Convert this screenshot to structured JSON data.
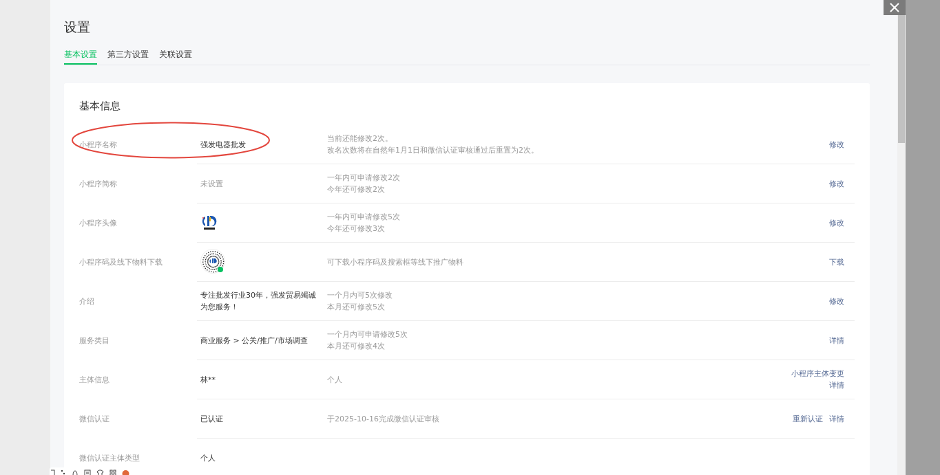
{
  "dialog": {
    "title": "设置"
  },
  "tabs": [
    {
      "label": "基本设置",
      "selected": true
    },
    {
      "label": "第三方设置",
      "selected": false
    },
    {
      "label": "关联设置",
      "selected": false
    }
  ],
  "section": {
    "title": "基本信息"
  },
  "rows": [
    {
      "label": "小程序名称",
      "kind": "text",
      "value": "强发电器批发",
      "muted": false,
      "highlighted": true,
      "desc": [
        "当前还能修改2次。",
        "改名次数将在自然年1月1日和微信认证审核通过后重置为2次。"
      ],
      "actions": [
        [
          "修改"
        ]
      ]
    },
    {
      "label": "小程序简称",
      "kind": "text",
      "value": "未设置",
      "muted": true,
      "highlighted": false,
      "desc": [
        "一年内可申请修改2次",
        "今年还可修改2次"
      ],
      "actions": [
        [
          "修改"
        ]
      ]
    },
    {
      "label": "小程序头像",
      "kind": "logo",
      "highlighted": false,
      "desc": [
        "一年内可申请修改5次",
        "今年还可修改3次"
      ],
      "actions": [
        [
          "修改"
        ]
      ]
    },
    {
      "label": "小程序码及线下物料下载",
      "kind": "qrcode",
      "highlighted": false,
      "desc": [
        "可下载小程序码及搜索框等线下推广物料"
      ],
      "actions": [
        [
          "下载"
        ]
      ]
    },
    {
      "label": "介绍",
      "kind": "text",
      "value": "专注批发行业30年，强发贸易竭诚为您服务！",
      "muted": false,
      "highlighted": false,
      "desc": [
        "一个月内可5次修改",
        "本月还可修改5次"
      ],
      "actions": [
        [
          "修改"
        ]
      ]
    },
    {
      "label": "服务类目",
      "kind": "text",
      "value": "商业服务 > 公关/推广/市场调查",
      "muted": false,
      "highlighted": false,
      "desc": [
        "一个月内可申请修改5次",
        "本月还可修改4次"
      ],
      "actions": [
        [
          "详情"
        ]
      ]
    },
    {
      "label": "主体信息",
      "kind": "text",
      "value": "林**",
      "muted": false,
      "highlighted": false,
      "desc": [
        "个人"
      ],
      "actions": [
        [
          "小程序主体变更"
        ],
        [
          "详情"
        ]
      ]
    },
    {
      "label": "微信认证",
      "kind": "text",
      "value": "已认证",
      "muted": false,
      "highlighted": false,
      "desc": [
        "于2025-10-16完成微信认证审核"
      ],
      "actions": [
        [
          "重新认证",
          "详情"
        ]
      ]
    },
    {
      "label": "微信认证主体类型",
      "kind": "text",
      "value": "个人",
      "muted": false,
      "highlighted": false,
      "desc": [],
      "actions": []
    }
  ]
}
